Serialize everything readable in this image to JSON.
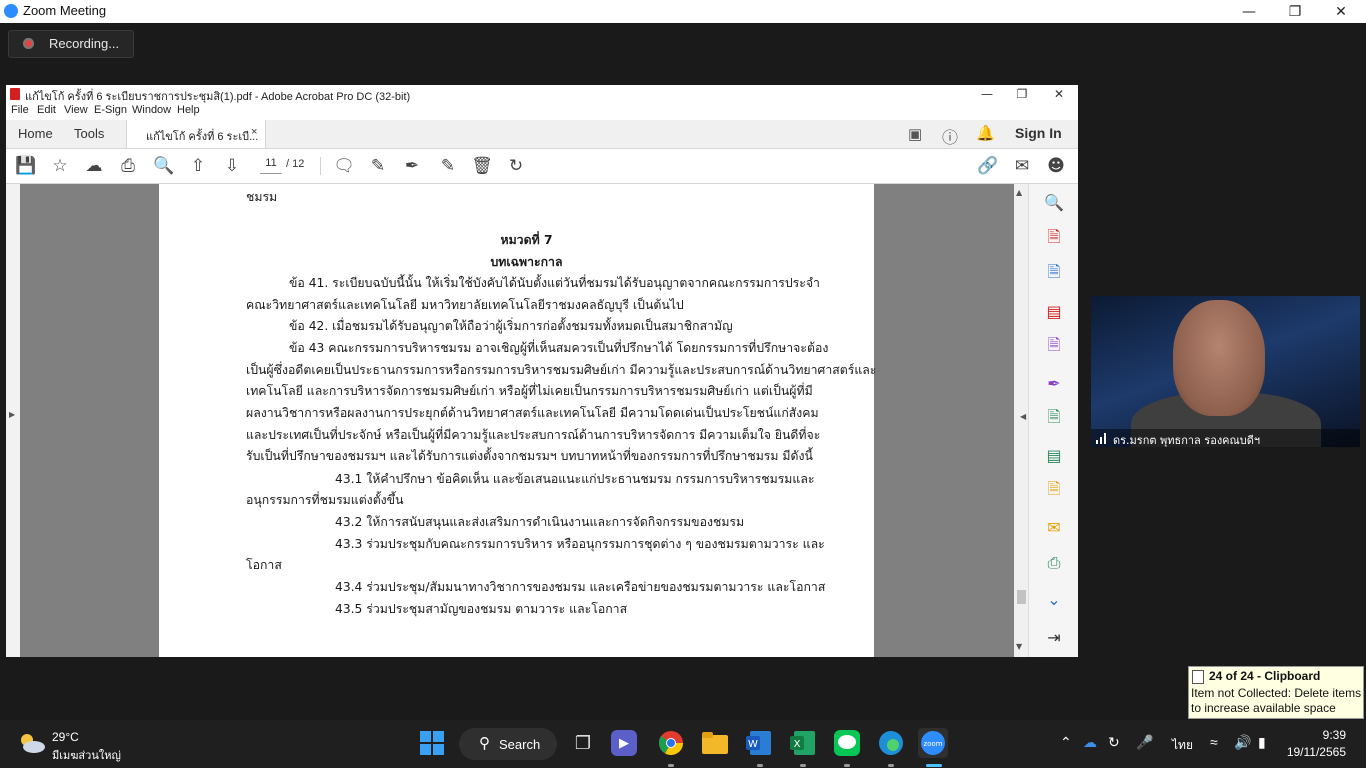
{
  "zoom": {
    "window_title": "Zoom Meeting",
    "recording_label": "Recording...",
    "participant_name": "ดร.มรกต พุทธกาล รองคณบดีฯ"
  },
  "acrobat": {
    "title": "แก้ไขโก้ ครั้งที่ 6 ระเบียบราชการประชุมสิ(1).pdf - Adobe Acrobat Pro DC (32-bit)",
    "menu": [
      "File",
      "Edit",
      "View",
      "E-Sign",
      "Window",
      "Help"
    ],
    "tabs": {
      "home": "Home",
      "tools": "Tools",
      "document": "แก้ไขโก้ ครั้งที่ 6  ระเบี...",
      "close": "×"
    },
    "sign_in": "Sign In",
    "page_current": "11",
    "page_total": "/ 12"
  },
  "document": {
    "lines": [
      "ชมรม",
      "หมวดที่ 7",
      "บทเฉพาะกาล",
      "ข้อ 41. ระเบียบฉบับนี้นั้น ให้เริ่มใช้บังคับได้นับตั้งแต่วันที่ชมรมได้รับอนุญาตจากคณะกรรมการประจำ",
      "คณะวิทยาศาสตร์และเทคโนโลยี มหาวิทยาลัยเทคโนโลยีราชมงคลธัญบุรี เป็นต้นไป",
      "ข้อ 42. เมื่อชมรมได้รับอนุญาตให้ถือว่าผู้เริ่มการก่อตั้งชมรมทั้งหมดเป็นสมาชิกสามัญ",
      "ข้อ 43  คณะกรรมการบริหารชมรม อาจเชิญผู้ที่เห็นสมควรเป็นที่ปรึกษาได้ โดยกรรมการที่ปรึกษาจะต้อง",
      "เป็นผู้ซึ่งอดีตเคยเป็นประธานกรรมการหรือกรรมการบริหารชมรมศิษย์เก่า  มีความรู้และประสบการณ์ด้านวิทยาศาสตร์และ",
      "เทคโนโลยี  และการบริหารจัดการชมรมศิษย์เก่า  หรือผู้ที่ไม่เคยเป็นกรรมการบริหารชมรมศิษย์เก่า  แต่เป็นผู้ที่มี",
      "ผลงานวิชาการหรือผลงานการประยุกต์ด้านวิทยาศาสตร์และเทคโนโลยี      มีความโดดเด่นเป็นประโยชน์แก่สังคม",
      "และประเทศเป็นที่ประจักษ์ หรือเป็นผู้ที่มีความรู้และประสบการณ์ด้านการบริหารจัดการ มีความเต็มใจ ยินดีที่จะ",
      "รับเป็นที่ปรึกษาของชมรมฯ  และได้รับการแต่งตั้งจากชมรมฯ  บทบาทหน้าที่ของกรรมการที่ปรึกษาชมรม  มีดังนี้",
      "43.1  ให้คำปรึกษา  ข้อคิดเห็น  และข้อเสนอแนะแก่ประธานชมรม  กรรมการบริหารชมรมและ",
      "อนุกรรมการที่ชมรมแต่งตั้งขึ้น",
      "43.2 ให้การสนับสนุนและส่งเสริมการดำเนินงานและการจัดกิจกรรมของชมรม",
      "43.3 ร่วมประชุมกับคณะกรรมการบริหาร หรืออนุกรรมการชุดต่าง ๆ ของชมรมตามวาระ และ",
      "โอกาส",
      "43.4 ร่วมประชุม/สัมมนาทางวิชาการของชมรม และเครือข่ายของชมรมตามวาระ และโอกาส",
      "43.5 ร่วมประชุมสามัญของชมรม ตามวาระ และโอกาส"
    ]
  },
  "clipboard_toast": {
    "title": "24 of 24 - Clipboard",
    "body": "Item not Collected: Delete items to increase available space"
  },
  "taskbar": {
    "temperature": "29°C",
    "weather": "มีเมฆส่วนใหญ่",
    "search_label": "Search",
    "language": "ไทย",
    "time": "9:39",
    "date": "19/11/2565"
  },
  "icons": {
    "zoom_brand": "zoom",
    "colors": {
      "zoom_blue": "#2D8CFF",
      "acrobat_red": "#d21f1f",
      "record_red": "#e04444",
      "page_gray": "#808080"
    }
  }
}
